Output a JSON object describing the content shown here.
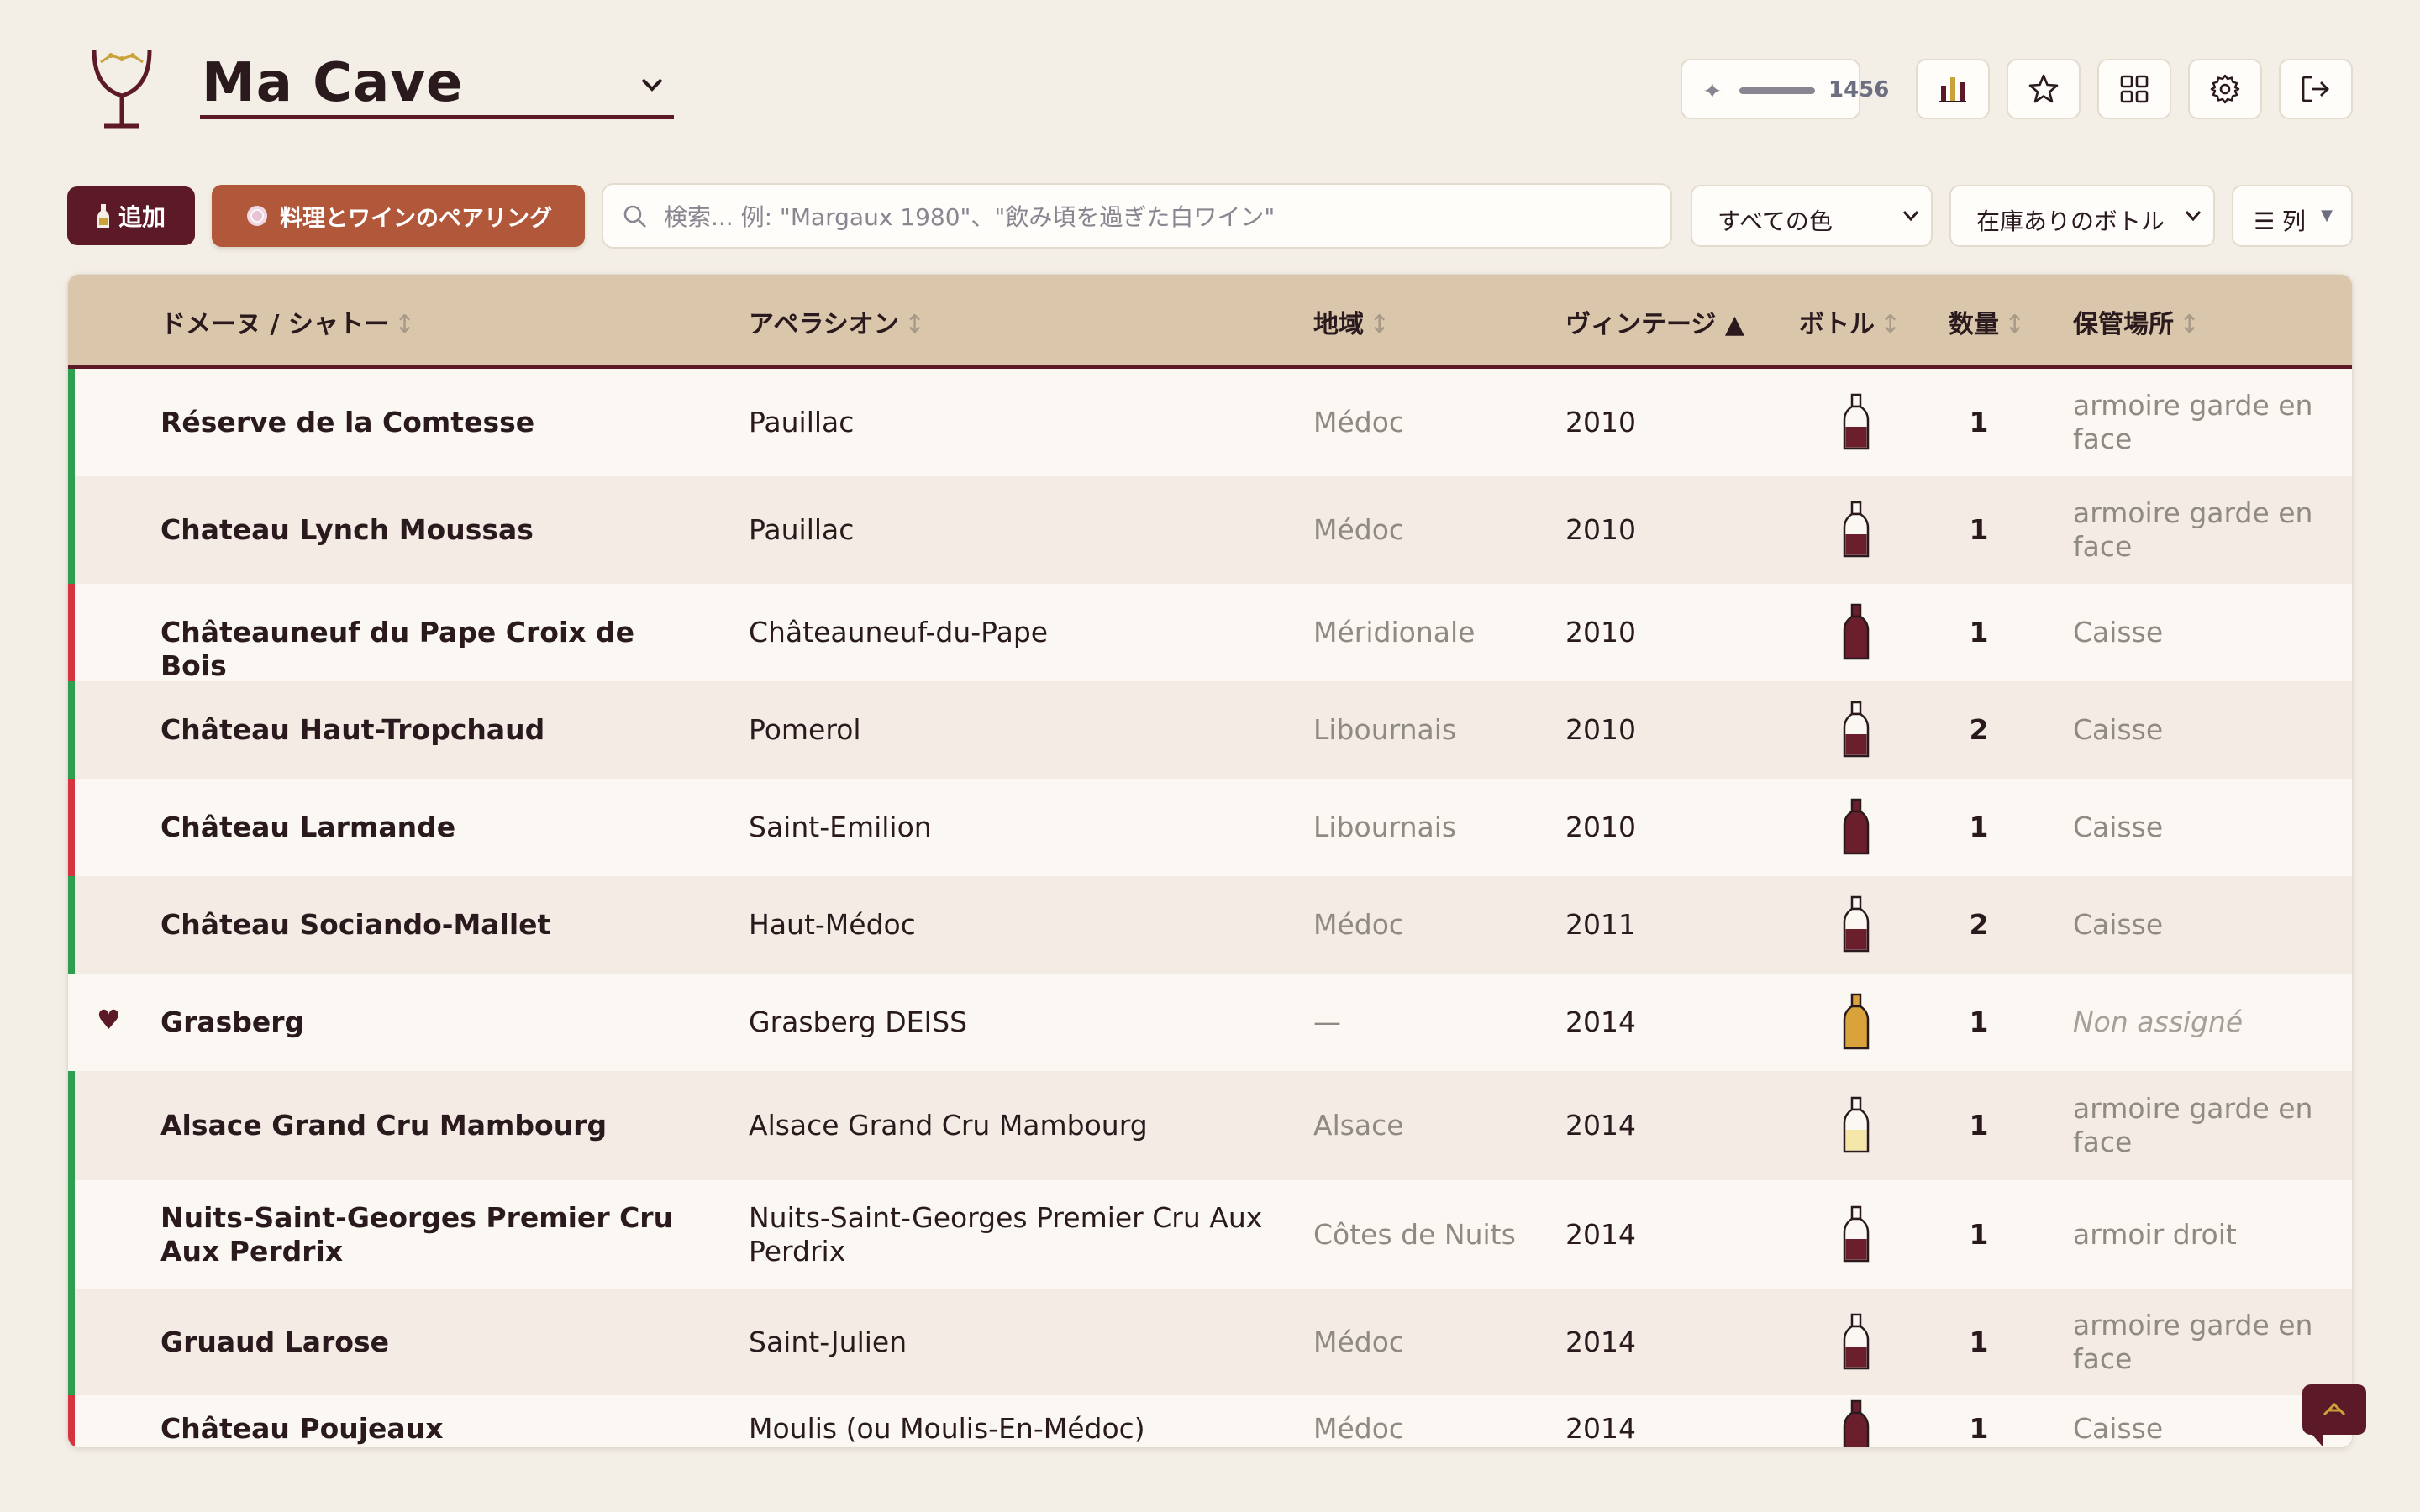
{
  "header": {
    "cellar_name": "Ma Cave",
    "points": "1456"
  },
  "toolbar": {
    "add_label": "追加",
    "pairing_label": "料理とワインのペアリング",
    "search_placeholder": "検索... 例: \"Margaux 1980\"、\"飲み頃を過ぎた白ワイン\"",
    "color_filter": "すべての色",
    "stock_filter": "在庫ありのボトル",
    "columns_label": "☰ 列"
  },
  "table": {
    "headers": {
      "name": "ドメーヌ / シャトー",
      "appellation": "アペラシオン",
      "region": "地域",
      "vintage": "ヴィンテージ ▲",
      "bottle": "ボトル",
      "qty": "数量",
      "location": "保管場所"
    },
    "sort_glyph": "↕",
    "rows": [
      {
        "name": "Réserve de la Comtesse",
        "appellation": "Pauillac",
        "region": "Médoc",
        "vintage": "2010",
        "qty": "1",
        "location": "armoire garde en face",
        "strip": "#2e9e4f",
        "bottle": "red-light"
      },
      {
        "name": "Chateau Lynch Moussas",
        "appellation": "Pauillac",
        "region": "Médoc",
        "vintage": "2010",
        "qty": "1",
        "location": "armoire garde en face",
        "strip": "#2e9e4f",
        "bottle": "red-light"
      },
      {
        "name": "Châteauneuf du Pape Croix de Bois",
        "appellation": "Châteauneuf-du-Pape",
        "region": "Méridionale",
        "vintage": "2010",
        "qty": "1",
        "location": "Caisse",
        "strip": "#d6343f",
        "bottle": "red-full"
      },
      {
        "name": "Château Haut-Tropchaud",
        "appellation": "Pomerol",
        "region": "Libournais",
        "vintage": "2010",
        "qty": "2",
        "location": "Caisse",
        "strip": "#2e9e4f",
        "bottle": "red-light"
      },
      {
        "name": "Château Larmande",
        "appellation": "Saint-Emilion",
        "region": "Libournais",
        "vintage": "2010",
        "qty": "1",
        "location": "Caisse",
        "strip": "#d6343f",
        "bottle": "red-full"
      },
      {
        "name": "Château Sociando-Mallet",
        "appellation": "Haut-Médoc",
        "region": "Médoc",
        "vintage": "2011",
        "qty": "2",
        "location": "Caisse",
        "strip": "#2e9e4f",
        "bottle": "red-light"
      },
      {
        "name": "Grasberg",
        "appellation": "Grasberg DEISS",
        "region": "—",
        "vintage": "2014",
        "qty": "1",
        "location": "Non assigné",
        "strip": "",
        "bottle": "amber",
        "favorite": true
      },
      {
        "name": "Alsace Grand Cru Mambourg",
        "appellation": "Alsace Grand Cru Mambourg",
        "region": "Alsace",
        "vintage": "2014",
        "qty": "1",
        "location": "armoire garde en face",
        "strip": "#2e9e4f",
        "bottle": "white"
      },
      {
        "name": "Nuits-Saint-Georges Premier Cru Aux Perdrix",
        "appellation": "Nuits-Saint-Georges Premier Cru Aux Perdrix",
        "region": "Côtes de Nuits",
        "vintage": "2014",
        "qty": "1",
        "location": "armoir droit",
        "strip": "#2e9e4f",
        "bottle": "red-light"
      },
      {
        "name": "Gruaud Larose",
        "appellation": "Saint-Julien",
        "region": "Médoc",
        "vintage": "2014",
        "qty": "1",
        "location": "armoire garde en face",
        "strip": "#2e9e4f",
        "bottle": "red-light"
      },
      {
        "name": "Château Poujeaux",
        "appellation": "Moulis (ou Moulis-En-Médoc)",
        "region": "Médoc",
        "vintage": "2014",
        "qty": "1",
        "location": "Caisse",
        "strip": "#d6343f",
        "bottle": "red-full"
      }
    ]
  },
  "colors": {
    "accent": "#5c1a28",
    "pairing": "#b2583a",
    "header_bg": "#d9c6ab",
    "ready": "#2e9e4f",
    "past_peak": "#d6343f"
  }
}
